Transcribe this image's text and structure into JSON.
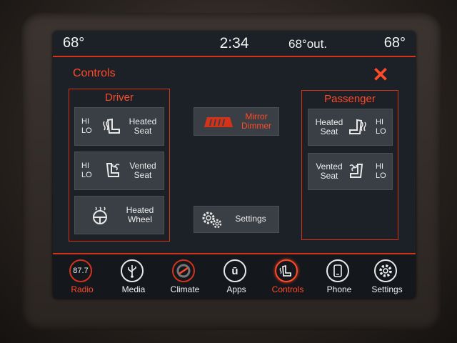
{
  "status": {
    "temp_left": "68°",
    "time": "2:34",
    "outside_temp": "68°out.",
    "temp_right": "68°"
  },
  "title": "Controls",
  "colors": {
    "accent": "#ff4a2a",
    "button_bg": "#3a3f45",
    "screen_bg": "#1c2128"
  },
  "driver": {
    "title": "Driver",
    "heated_seat": {
      "hi": "HI",
      "lo": "LO",
      "label1": "Heated",
      "label2": "Seat",
      "icon": "heated-seat-icon"
    },
    "vented_seat": {
      "hi": "HI",
      "lo": "LO",
      "label1": "Vented",
      "label2": "Seat",
      "icon": "vented-seat-icon"
    },
    "heated_wheel": {
      "label1": "Heated",
      "label2": "Wheel",
      "icon": "heated-wheel-icon"
    }
  },
  "center": {
    "mirror_dimmer": {
      "label1": "Mirror",
      "label2": "Dimmer",
      "icon": "mirror-icon"
    },
    "settings": {
      "label": "Settings",
      "icon": "gears-icon"
    }
  },
  "passenger": {
    "title": "Passenger",
    "heated_seat": {
      "hi": "HI",
      "lo": "LO",
      "label1": "Heated",
      "label2": "Seat",
      "icon": "heated-seat-icon"
    },
    "vented_seat": {
      "hi": "HI",
      "lo": "LO",
      "label1": "Vented",
      "label2": "Seat",
      "icon": "vented-seat-icon"
    }
  },
  "nav": [
    {
      "label": "Radio",
      "icon_text": "87.7",
      "icon": "radio-icon",
      "active": false,
      "label_color": "#ff4a2a"
    },
    {
      "label": "Media",
      "icon": "usb-icon"
    },
    {
      "label": "Climate",
      "icon": "climate-icon"
    },
    {
      "label": "Apps",
      "icon": "apps-icon"
    },
    {
      "label": "Controls",
      "icon": "controls-icon",
      "active": true
    },
    {
      "label": "Phone",
      "icon": "phone-icon"
    },
    {
      "label": "Settings",
      "icon": "gear-icon"
    }
  ]
}
